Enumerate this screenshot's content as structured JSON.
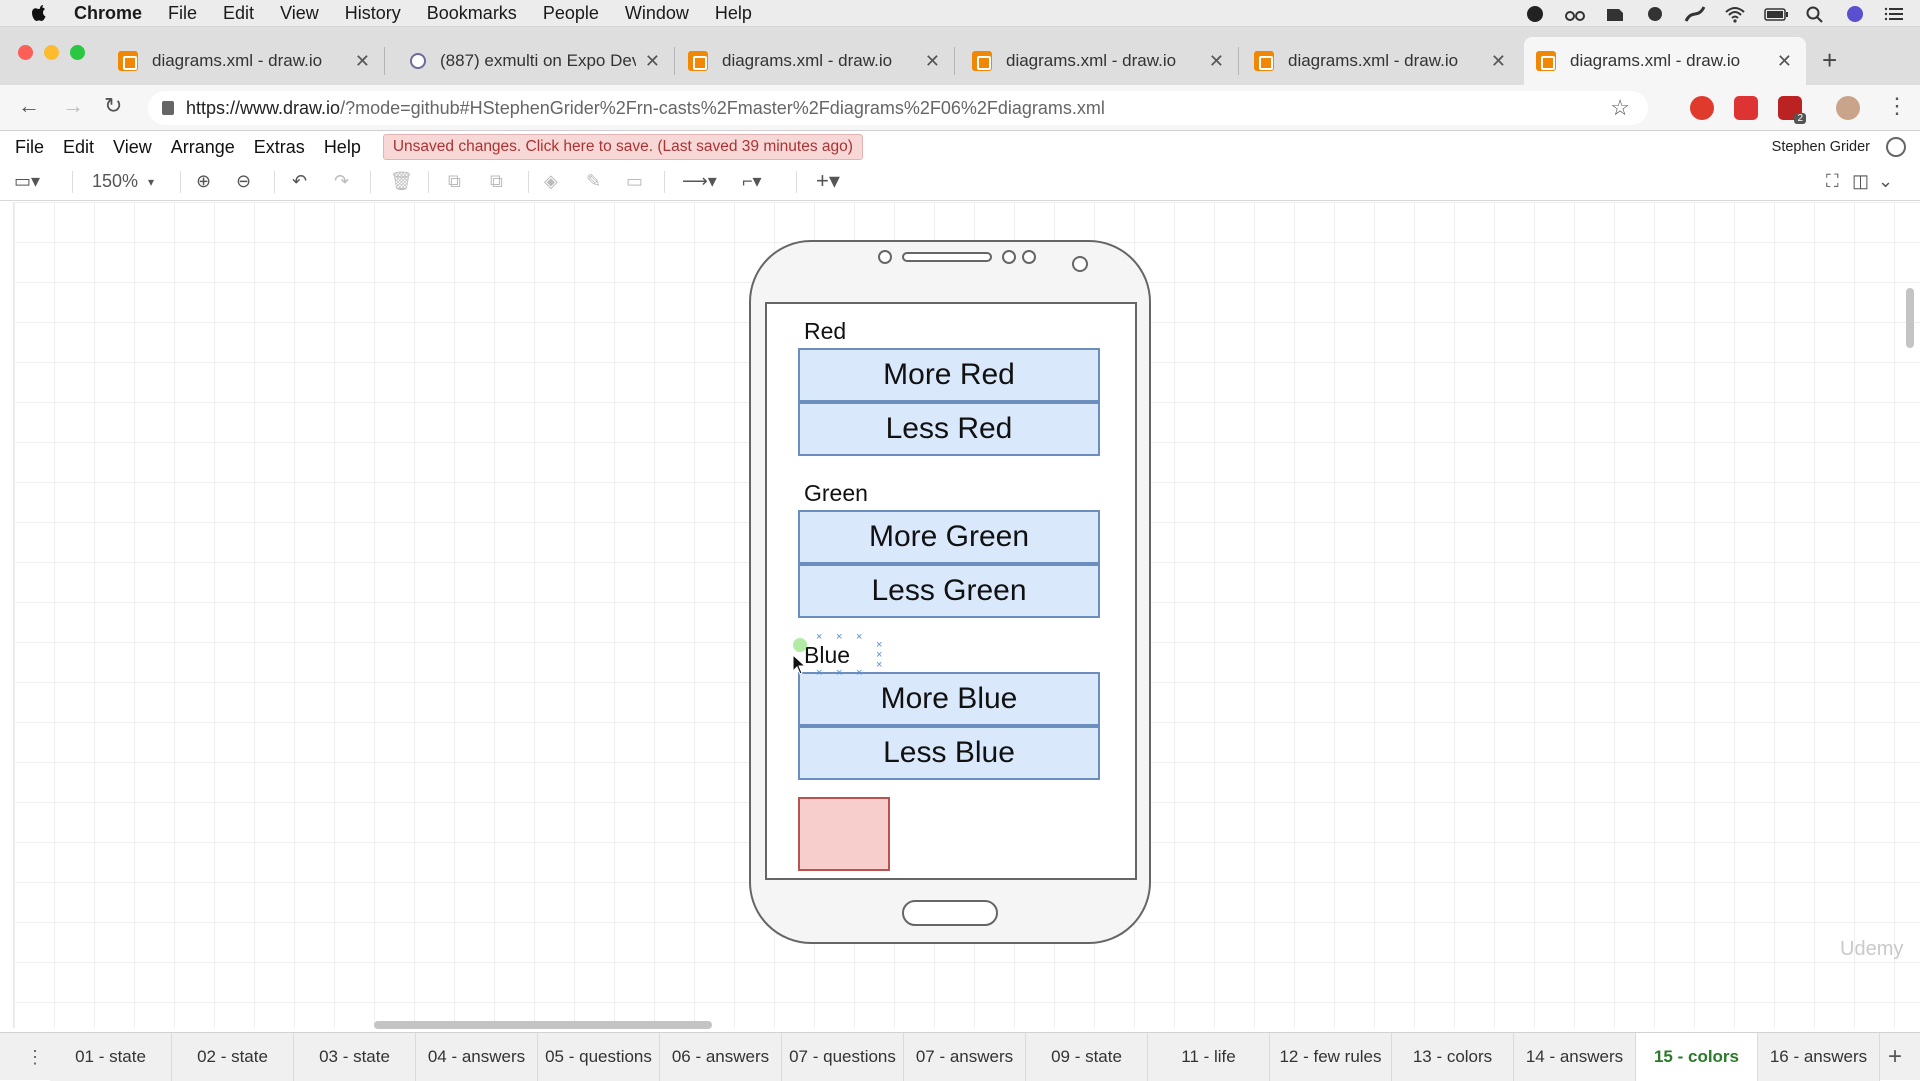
{
  "mac_menu": {
    "app": "Chrome",
    "items": [
      "File",
      "Edit",
      "View",
      "History",
      "Bookmarks",
      "People",
      "Window",
      "Help"
    ]
  },
  "browser": {
    "tabs": [
      {
        "title": "diagrams.xml - draw.io",
        "icon": "drawio-icon"
      },
      {
        "title": "(887) exmulti on Expo Dev",
        "icon": "expo-icon"
      },
      {
        "title": "diagrams.xml - draw.io",
        "icon": "drawio-icon"
      },
      {
        "title": "diagrams.xml - draw.io",
        "icon": "drawio-icon"
      },
      {
        "title": "diagrams.xml - draw.io",
        "icon": "drawio-icon"
      },
      {
        "title": "diagrams.xml - draw.io",
        "icon": "drawio-icon",
        "active": true
      }
    ],
    "url_host": "https://www.draw.io",
    "url_path": "/?mode=github#HStephenGrider%2Frn-casts%2Fmaster%2Fdiagrams%2F06%2Fdiagrams.xml",
    "extension_badge": "2"
  },
  "app": {
    "menu": [
      "File",
      "Edit",
      "View",
      "Arrange",
      "Extras",
      "Help"
    ],
    "unsaved_notice": "Unsaved changes. Click here to save. (Last saved 39 minutes ago)",
    "user": "Stephen Grider",
    "zoom": "150%"
  },
  "diagram": {
    "sections": [
      {
        "label": "Red",
        "buttons": [
          "More Red",
          "Less Red"
        ]
      },
      {
        "label": "Green",
        "buttons": [
          "More Green",
          "Less Green"
        ]
      },
      {
        "label": "Blue",
        "buttons": [
          "More Blue",
          "Less Blue"
        ]
      }
    ],
    "swatch_color": "#f8cecc",
    "button_fill": "#dae8fc",
    "button_stroke": "#6c8ebf"
  },
  "watermark": "Udemy",
  "pages": {
    "tabs": [
      "01 - state",
      "02 - state",
      "03 - state",
      "04 - answers",
      "05 - questions",
      "06 - answers",
      "07 - questions",
      "07 - answers",
      "09 - state",
      "11 - life",
      "12 - few rules",
      "13 - colors",
      "14 - answers",
      "15 - colors",
      "16 - answers"
    ],
    "active": "15 - colors"
  }
}
